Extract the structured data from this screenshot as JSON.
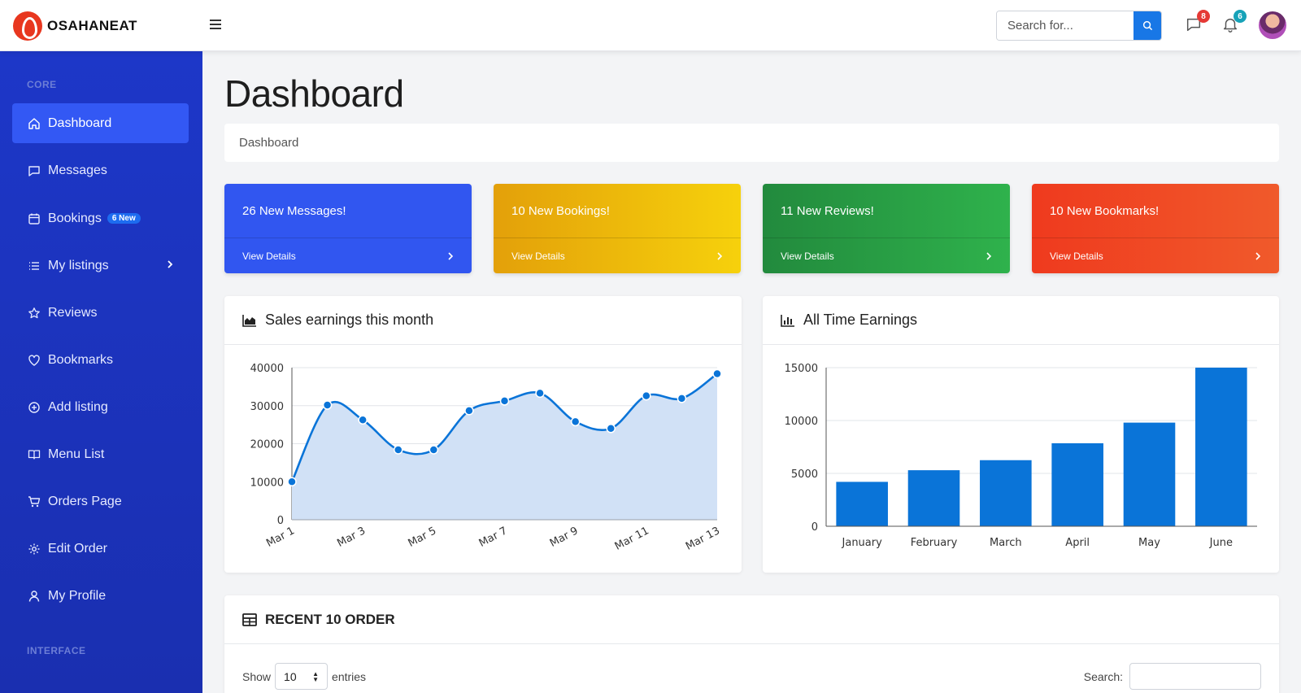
{
  "brand": {
    "name": "OSAHANEAT"
  },
  "topbar": {
    "search_placeholder": "Search for...",
    "messages_count": "8",
    "notifications_count": "6",
    "colors": {
      "accent": "#1877e6",
      "messages_badge": "#e53935",
      "notifications_badge": "#17a2b8"
    }
  },
  "sidebar": {
    "heading_core": "CORE",
    "heading_interface": "INTERFACE",
    "items": [
      {
        "label": "Dashboard",
        "icon": "home-icon",
        "active": true
      },
      {
        "label": "Messages",
        "icon": "message-icon"
      },
      {
        "label": "Bookings",
        "icon": "calendar-icon",
        "badge": "6 New"
      },
      {
        "label": "My listings",
        "icon": "list-icon",
        "has_submenu": true
      },
      {
        "label": "Reviews",
        "icon": "star-icon"
      },
      {
        "label": "Bookmarks",
        "icon": "heart-icon"
      },
      {
        "label": "Add listing",
        "icon": "plus-circle-icon"
      },
      {
        "label": "Menu List",
        "icon": "book-icon"
      },
      {
        "label": "Orders Page",
        "icon": "cart-icon"
      },
      {
        "label": "Edit Order",
        "icon": "gear-icon"
      },
      {
        "label": "My Profile",
        "icon": "user-icon"
      }
    ]
  },
  "page": {
    "title": "Dashboard",
    "breadcrumb": "Dashboard"
  },
  "stats": [
    {
      "title": "26 New Messages!",
      "link": "View Details",
      "color": "#3156f0"
    },
    {
      "title": "10 New Bookings!",
      "link": "View Details",
      "color": "#f0b90b"
    },
    {
      "title": "11 New Reviews!",
      "link": "View Details",
      "color": "#2a9d44"
    },
    {
      "title": "10 New Bookmarks!",
      "link": "View Details",
      "color": "#ef4a24"
    }
  ],
  "cards": {
    "sales_title": "Sales earnings this month",
    "earnings_title": "All Time Earnings",
    "orders_title": "RECENT 10 ORDER"
  },
  "table": {
    "show_label": "Show",
    "entries_value": "10",
    "entries_label": "entries",
    "search_label": "Search:"
  },
  "chart_data": [
    {
      "type": "area",
      "title": "Sales earnings this month",
      "x": [
        "Mar 1",
        "Mar 2",
        "Mar 3",
        "Mar 4",
        "Mar 5",
        "Mar 6",
        "Mar 7",
        "Mar 8",
        "Mar 9",
        "Mar 10",
        "Mar 11",
        "Mar 12",
        "Mar 13"
      ],
      "x_tick_labels": [
        "Mar 1",
        "Mar 3",
        "Mar 5",
        "Mar 7",
        "Mar 9",
        "Mar 11",
        "Mar 13"
      ],
      "values": [
        10000,
        30150,
        26250,
        18400,
        18400,
        28700,
        31250,
        33300,
        25800,
        24000,
        32600,
        31900,
        38400
      ],
      "ylim": [
        0,
        40000
      ],
      "y_ticks": [
        0,
        10000,
        20000,
        30000,
        40000
      ],
      "grid": true,
      "line_color": "#0a74d8",
      "fill_color": "#d1e1f6"
    },
    {
      "type": "bar",
      "title": "All Time Earnings",
      "categories": [
        "January",
        "February",
        "March",
        "April",
        "May",
        "June"
      ],
      "values": [
        4200,
        5300,
        6250,
        7850,
        9800,
        15000
      ],
      "ylim": [
        0,
        15000
      ],
      "y_ticks": [
        0,
        5000,
        10000,
        15000
      ],
      "grid": true,
      "bar_color": "#0a74d8"
    }
  ]
}
